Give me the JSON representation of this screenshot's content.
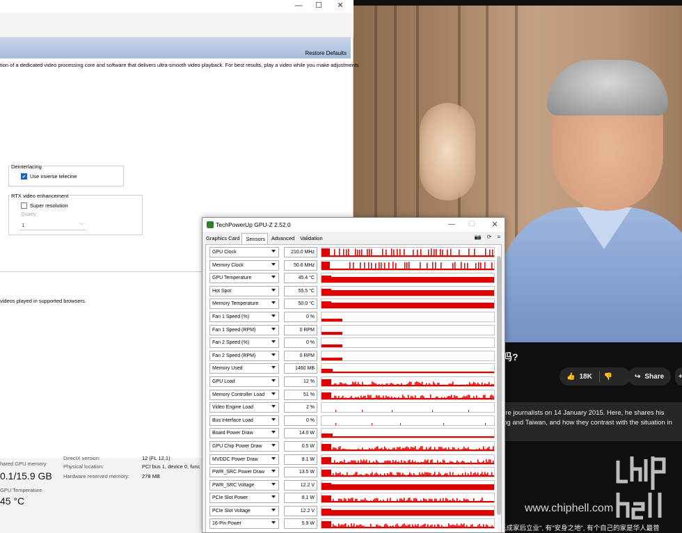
{
  "nvidia": {
    "restore_defaults": "Restore Defaults",
    "description": "tion of a dedicated video processing core and software that delivers ultra-smooth video playback. For best results, play a video while you make adjustments",
    "deinterlacing_title": "Deinterlacing",
    "inverse_telecine_label": "Use inverse telecine",
    "rtx_title": "RTX video enhancement",
    "super_resolution_label": "Super resolution",
    "quality_label": "Quality:",
    "quality_value": "1",
    "browser_note": "videos played in supported browsers."
  },
  "task_manager": {
    "shared_gpu_label": "hared GPU memory",
    "shared_gpu_value": "0.1/15.9 GB",
    "gpu_temp_label": "GPU Temperature",
    "gpu_temp_value": "45 °C",
    "directx_label": "DirectX version:",
    "directx_value": "12 (FL 12.1)",
    "physical_location_label": "Physical location:",
    "physical_location_value": "PCI bus 1, device 0, func",
    "hw_reserved_label": "Hardware reserved memory:",
    "hw_reserved_value": "278 MB"
  },
  "video": {
    "title_fragment": "吗?",
    "likes": "18K",
    "share_label": "Share",
    "desc_line1": "ore journalists on 14 January 2015. Here, he shares his",
    "desc_line2": "ing and Taiwan, and how they contrast with the situation in",
    "watermark": "www.chiphell.com",
    "bottom_caption": "先成家后立业\", 有\"安身之地\", 有个自己的家是华人最普"
  },
  "gpuz": {
    "title": "TechPowerUp GPU-Z 2.52.0",
    "tabs": [
      "Graphics Card",
      "Sensors",
      "Advanced",
      "Validation"
    ],
    "active_tab": "Sensors",
    "sensors": [
      {
        "name": "GPU Clock",
        "value": "210.0 MHz"
      },
      {
        "name": "Memory Clock",
        "value": "50.6 MHz"
      },
      {
        "name": "GPU Temperature",
        "value": "45.4 °C"
      },
      {
        "name": "Hot Spot",
        "value": "55.5 °C"
      },
      {
        "name": "Memory Temperature",
        "value": "50.0 °C"
      },
      {
        "name": "Fan 1 Speed (%)",
        "value": "0 %"
      },
      {
        "name": "Fan 1 Speed (RPM)",
        "value": "0 RPM"
      },
      {
        "name": "Fan 2 Speed (%)",
        "value": "0 %"
      },
      {
        "name": "Fan 2 Speed (RPM)",
        "value": "0 RPM"
      },
      {
        "name": "Memory Used",
        "value": "1460 MB"
      },
      {
        "name": "GPU Load",
        "value": "12 %"
      },
      {
        "name": "Memory Controller Load",
        "value": "51 %"
      },
      {
        "name": "Video Engine Load",
        "value": "2 %"
      },
      {
        "name": "Bus Interface Load",
        "value": "0 %"
      },
      {
        "name": "Board Power Draw",
        "value": "14.0 W"
      },
      {
        "name": "GPU Chip Power Draw",
        "value": "0.5 W"
      },
      {
        "name": "MVDDC Power Draw",
        "value": "8.1 W"
      },
      {
        "name": "PWR_SRC Power Draw",
        "value": "13.5 W"
      },
      {
        "name": "PWR_SRC Voltage",
        "value": "12.2 V"
      },
      {
        "name": "PCIe Slot Power",
        "value": "8.1 W"
      },
      {
        "name": "PCIe Slot Voltage",
        "value": "12.2 V"
      },
      {
        "name": "16-Pin Power",
        "value": "5.9 W"
      }
    ],
    "graph_color": "#e00000"
  }
}
